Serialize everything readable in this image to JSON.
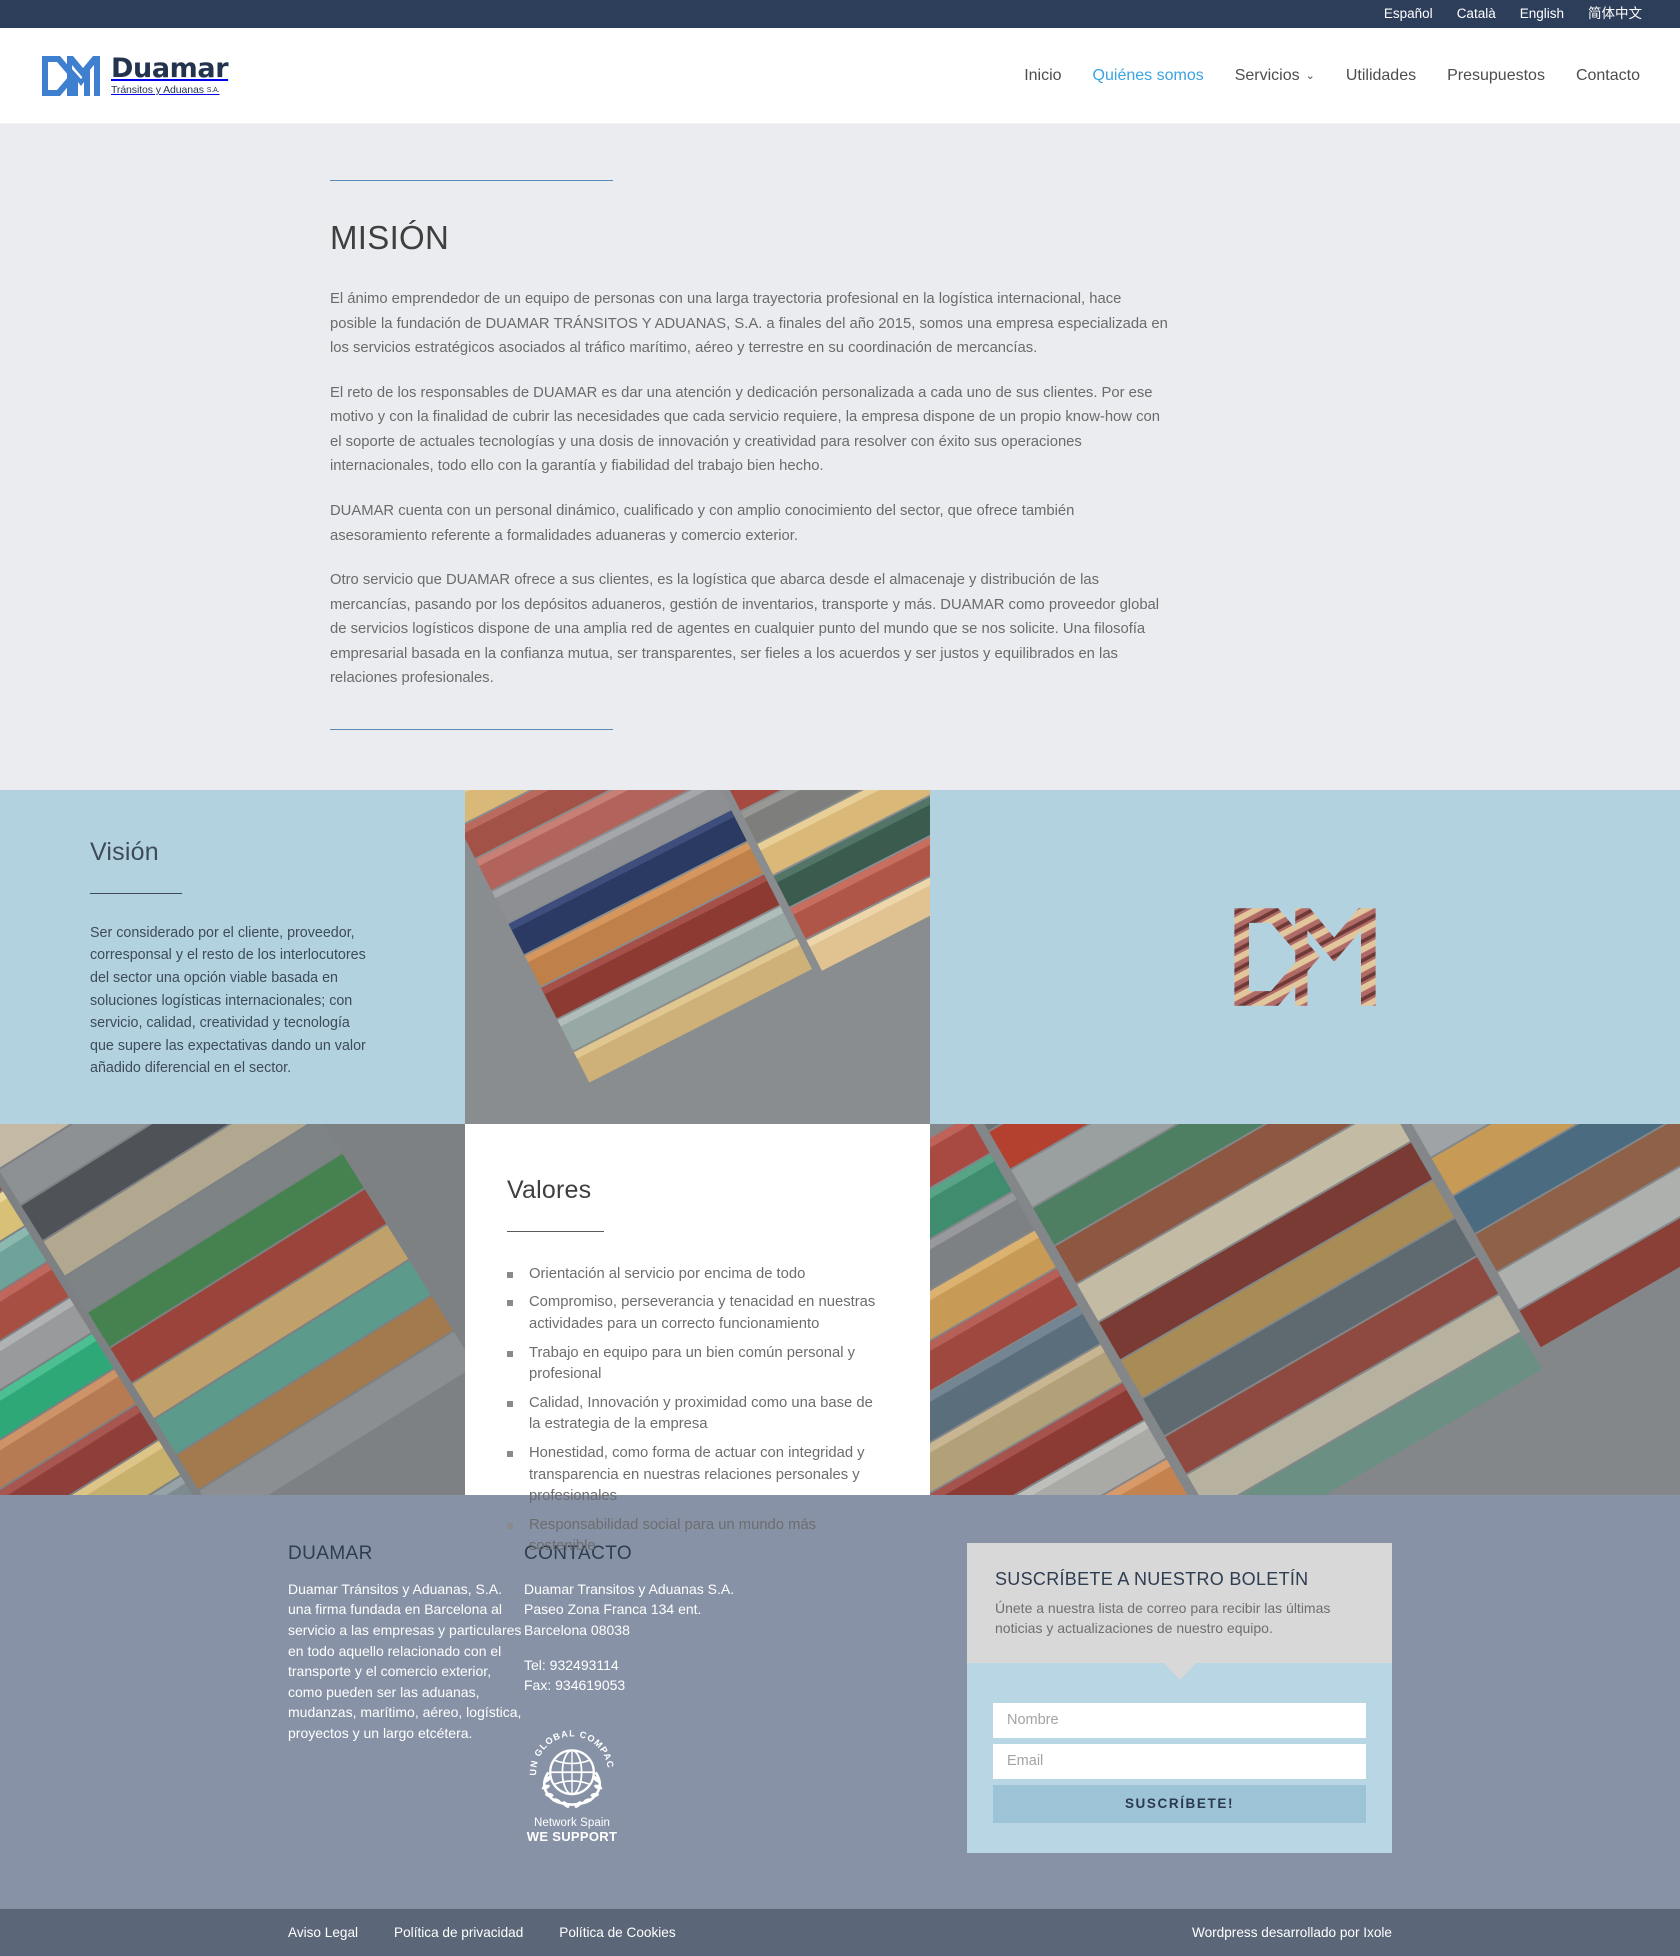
{
  "langbar": {
    "items": [
      {
        "label": "Español"
      },
      {
        "label": "Català"
      },
      {
        "label": "English"
      },
      {
        "label": "简体中文"
      }
    ]
  },
  "header": {
    "logo": {
      "name": "Duamar",
      "subtitle": "Tránsitos y Aduanas",
      "subtitle_suffix": "S.A.",
      "mark_color": "#3f7fd0"
    },
    "nav": [
      {
        "label": "Inicio",
        "active": false,
        "has_caret": false
      },
      {
        "label": "Quiénes somos",
        "active": true,
        "has_caret": false
      },
      {
        "label": "Servicios",
        "active": false,
        "has_caret": true
      },
      {
        "label": "Utilidades",
        "active": false,
        "has_caret": false
      },
      {
        "label": "Presupuestos",
        "active": false,
        "has_caret": false
      },
      {
        "label": "Contacto",
        "active": false,
        "has_caret": false
      }
    ],
    "caret_glyph": "⌄"
  },
  "mission": {
    "title": "MISIÓN",
    "paragraphs": [
      "El ánimo emprendedor de un equipo de personas con una larga trayectoria profesional en la logística internacional, hace posible la fundación de DUAMAR TRÁNSITOS Y ADUANAS, S.A. a finales del año 2015, somos una empresa especializada en los servicios estratégicos asociados al tráfico marítimo, aéreo y terrestre en su coordinación de mercancías.",
      "El reto de los responsables de DUAMAR es dar una atención y dedicación personalizada a cada uno de sus clientes. Por ese motivo y con la finalidad de cubrir las necesidades que cada servicio requiere, la empresa dispone de un propio know-how con el soporte de actuales tecnologías y una dosis de innovación y creatividad para resolver con éxito sus operaciones internacionales, todo ello con la garantía y fiabilidad del trabajo bien hecho.",
      "DUAMAR cuenta con un personal dinámico, cualificado y con amplio conocimiento del sector, que ofrece también asesoramiento referente a formalidades aduaneras y comercio exterior.",
      "Otro servicio que DUAMAR ofrece a sus clientes, es la logística que abarca desde el almacenaje y distribución de las mercancías, pasando por los depósitos aduaneros, gestión de inventarios, transporte y más. DUAMAR como proveedor global de servicios logísticos dispone de una amplia red de agentes en cualquier punto del mundo que se nos solicite. Una filosofía empresarial basada en la confianza mutua, ser transparentes, ser fieles a los acuerdos y ser justos y equilibrados en las relaciones profesionales."
    ],
    "background": "#eaecef"
  },
  "vision": {
    "title": "Visión",
    "text": "Ser considerado por el cliente, proveedor, corresponsal y el resto de los interlocutores del sector una opción viable basada  en soluciones logísticas internacionales; con servicio, calidad, creatividad y tecnología que supere las expectativas dando un valor añadido diferencial en el sector.",
    "background": "#b3d2df",
    "photo_alt": "stacked-shipping-containers-aerial"
  },
  "valores": {
    "title": "Valores",
    "items": [
      "Orientación al servicio por encima de todo",
      "Compromiso, perseverancia y tenacidad en nuestras actividades para un correcto funcionamiento",
      "Trabajo en equipo para un bien común personal y profesional",
      "Calidad, Innovación y proximidad como una base de la estrategia de la empresa",
      "Honestidad, como forma de actuar con integridad y transparencia en nuestras relaciones personales y profesionales",
      "Responsabilidad social para un mundo más sostenible"
    ],
    "photo_left_alt": "container-yard-aerial-left",
    "photo_right_alt": "container-stack-aerial-right"
  },
  "footer": {
    "background": "#8792a6",
    "col_duamar": {
      "heading": "DUAMAR",
      "text": "Duamar Tránsitos y Aduanas, S.A. una firma fundada en Barcelona al servicio a las empresas y particulares en todo aquello relacionado con el transporte y el comercio exterior, como pueden ser las aduanas, mudanzas, marítimo, aéreo, logística, proyectos y un largo etcétera."
    },
    "col_contacto": {
      "heading": "CONTACTO",
      "company": "Duamar Transitos y Aduanas S.A.",
      "address1": "Paseo Zona Franca 134 ent.",
      "address2": "Barcelona 08038",
      "tel": "Tel: 932493114",
      "fax": "Fax: 934619053",
      "badge_ring": "UN GLOBAL COMPACT",
      "badge_caption1": "Network Spain",
      "badge_caption2": "WE SUPPORT"
    },
    "newsletter": {
      "title": "SUSCRÍBETE A NUESTRO BOLETÍN",
      "subtitle": "Únete a nuestra lista de correo para recibir las últimas noticias y actualizaciones de nuestro equipo.",
      "name_placeholder": "Nombre",
      "name_value": "",
      "email_placeholder": "Email",
      "email_value": "",
      "button_label": "SUSCRÍBETE!",
      "head_bg": "#d8d8d8",
      "body_bg": "#b8d6e3",
      "button_bg": "#9dc4d6"
    }
  },
  "bottombar": {
    "background": "#5b6778",
    "links": [
      {
        "label": "Aviso Legal"
      },
      {
        "label": "Política de privacidad"
      },
      {
        "label": "Política de Cookies"
      }
    ],
    "credit": "Wordpress desarrollado por Ixole"
  }
}
